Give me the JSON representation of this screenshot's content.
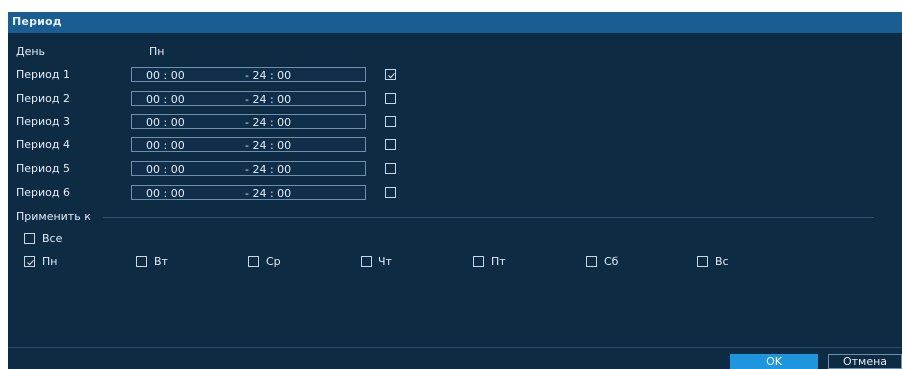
{
  "dialog": {
    "title": "Период"
  },
  "day": {
    "label": "День",
    "value": "Пн"
  },
  "periods": [
    {
      "label": "Период 1",
      "start": "00 :  00",
      "end": "-  24 :  00",
      "checked": true
    },
    {
      "label": "Период 2",
      "start": "00 :  00",
      "end": "-  24 :  00",
      "checked": false
    },
    {
      "label": "Период 3",
      "start": "00 :  00",
      "end": "-  24 :  00",
      "checked": false
    },
    {
      "label": "Период 4",
      "start": "00 :  00",
      "end": "-  24 :  00",
      "checked": false
    },
    {
      "label": "Период 5",
      "start": "00 :  00",
      "end": "-  24 :  00",
      "checked": false
    },
    {
      "label": "Период 6",
      "start": "00 :  00",
      "end": "-  24 :  00",
      "checked": false
    }
  ],
  "apply": {
    "label": "Применить к",
    "all": {
      "label": "Все",
      "checked": false
    },
    "days": [
      {
        "label": "Пн",
        "checked": true
      },
      {
        "label": "Вт",
        "checked": false
      },
      {
        "label": "Ср",
        "checked": false
      },
      {
        "label": "Чт",
        "checked": false
      },
      {
        "label": "Пт",
        "checked": false
      },
      {
        "label": "Сб",
        "checked": false
      },
      {
        "label": "Вс",
        "checked": false
      }
    ]
  },
  "buttons": {
    "ok": "OK",
    "cancel": "Отмена"
  },
  "colors": {
    "background": "#0e2b44",
    "titlebar": "#1a5d93",
    "accent": "#1e95dd"
  }
}
